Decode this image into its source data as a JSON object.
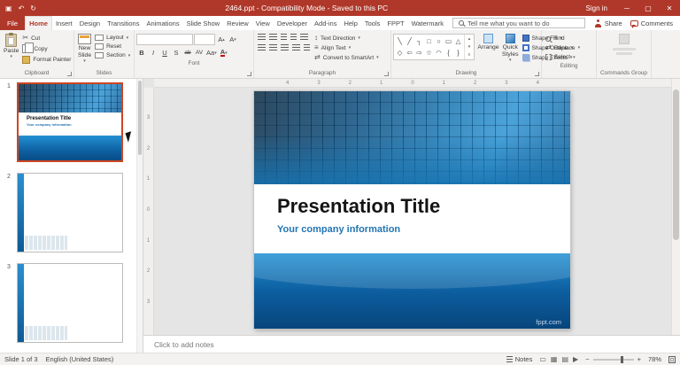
{
  "app": {
    "accent": "#b0382a"
  },
  "titlebar": {
    "title": "2464.ppt - Compatibility Mode - Saved to this PC",
    "sign_in": "Sign in"
  },
  "icons": {
    "save": "▣",
    "undo": "↶",
    "redo": "↻",
    "minimize": "─",
    "maximize": "▢",
    "close": "✕",
    "chevron_down": "▾",
    "chevron_up": "▴",
    "scissors": "✂",
    "updown": "↕",
    "lines": "≡",
    "swap": "⇄",
    "more": "≡",
    "minus": "−",
    "plus": "+",
    "view_normal": "▭",
    "view_sorter": "▦",
    "view_reading": "▤",
    "view_slideshow": "▶"
  },
  "ribbon": {
    "tabs": [
      "File",
      "Home",
      "Insert",
      "Design",
      "Transitions",
      "Animations",
      "Slide Show",
      "Review",
      "View",
      "Developer",
      "Add-ins",
      "Help",
      "Tools",
      "FPPT",
      "Watermark"
    ],
    "tell_me": "Tell me what you want to do",
    "share": "Share",
    "comments": "Comments",
    "clipboard": {
      "label": "Clipboard",
      "paste": "Paste",
      "cut": "Cut",
      "copy": "Copy",
      "format_painter": "Format Painter"
    },
    "slides": {
      "label": "Slides",
      "new_slide": "New Slide",
      "layout": "Layout",
      "reset": "Reset",
      "section": "Section"
    },
    "font": {
      "label": "Font",
      "name": "",
      "size": "",
      "grow": "A",
      "shrink": "A",
      "bold": "B",
      "italic": "I",
      "underline": "U",
      "shadow": "S",
      "strike": "ab",
      "spacing": "AV",
      "case": "Aa",
      "color": "A"
    },
    "paragraph": {
      "label": "Paragraph",
      "text_direction": "Text Direction",
      "align_text": "Align Text",
      "smartart": "Convert to SmartArt"
    },
    "drawing": {
      "label": "Drawing",
      "arrange": "Arrange",
      "quick_styles": "Quick Styles",
      "shape_fill": "Shape Fill",
      "shape_outline": "Shape Outline",
      "shape_effects": "Shape Effects",
      "shapes_row1": [
        "╲",
        "╱",
        "┐",
        "□",
        "○",
        "▭",
        "△"
      ],
      "shapes_row2": [
        "◇",
        "⇦",
        "⇨",
        "☆",
        "◠",
        "{",
        "}"
      ]
    },
    "editing": {
      "label": "Editing",
      "find": "Find",
      "replace": "Replace",
      "select": "Select"
    },
    "commands": {
      "label": "Commands Group"
    }
  },
  "thumbnails": [
    {
      "num": "1",
      "title": "Presentation Title",
      "subtitle": "Your company information"
    },
    {
      "num": "2"
    },
    {
      "num": "3"
    }
  ],
  "rulers": {
    "h": [
      "4",
      "3",
      "2",
      "1",
      "0",
      "1",
      "2",
      "3",
      "4"
    ],
    "v": [
      "3",
      "2",
      "1",
      "0",
      "1",
      "2",
      "3"
    ]
  },
  "slide": {
    "title": "Presentation Title",
    "subtitle": "Your company information",
    "watermark": "fppt.com"
  },
  "notes": {
    "placeholder": "Click to add notes"
  },
  "statusbar": {
    "slide_info": "Slide 1 of 3",
    "language": "English (United States)",
    "notes_label": "Notes",
    "zoom": "78%"
  }
}
